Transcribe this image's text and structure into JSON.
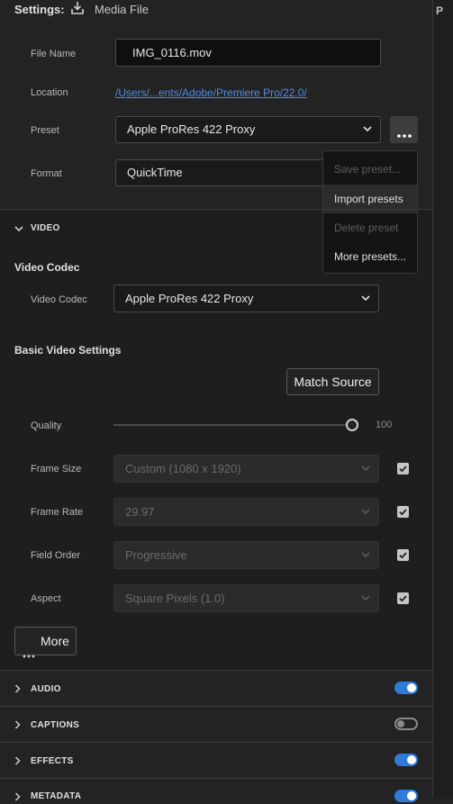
{
  "header": {
    "settings_label": "Settings:",
    "output_label": "Media File",
    "icon": "download-icon"
  },
  "fields": {
    "file_name": {
      "label": "File Name",
      "value": "IMG_0116.mov"
    },
    "location": {
      "label": "Location",
      "value": "/Users/...ents/Adobe/Premiere Pro/22.0/"
    },
    "preset": {
      "label": "Preset",
      "value": "Apple ProRes 422 Proxy"
    },
    "format": {
      "label": "Format",
      "value": "QuickTime"
    }
  },
  "preset_menu": {
    "items": [
      {
        "label": "Save preset...",
        "enabled": false
      },
      {
        "label": "Import presets",
        "enabled": true
      },
      {
        "label": "Delete preset",
        "enabled": false
      },
      {
        "label": "More presets...",
        "enabled": true
      }
    ]
  },
  "video": {
    "section_title": "VIDEO",
    "codec_heading": "Video Codec",
    "codec_label": "Video Codec",
    "codec_value": "Apple ProRes 422 Proxy",
    "basic_heading": "Basic Video Settings",
    "match_source": "Match Source",
    "quality_label": "Quality",
    "quality_value": "100",
    "quality_fraction": 1.0,
    "frame_size": {
      "label": "Frame Size",
      "value": "Custom (1080 x 1920)",
      "checked": true
    },
    "frame_rate": {
      "label": "Frame Rate",
      "value": "29.97",
      "checked": true
    },
    "field_order": {
      "label": "Field Order",
      "value": "Progressive",
      "checked": true
    },
    "aspect": {
      "label": "Aspect",
      "value": "Square Pixels (1.0)",
      "checked": true
    },
    "more_button": "More"
  },
  "sections": [
    {
      "title": "AUDIO",
      "enabled": true
    },
    {
      "title": "CAPTIONS",
      "enabled": false
    },
    {
      "title": "EFFECTS",
      "enabled": true
    },
    {
      "title": "METADATA",
      "enabled": true
    }
  ],
  "right_panel_letter": "P",
  "colors": {
    "accent": "#2f7bd9",
    "link": "#4c8ee8",
    "background": "#232323"
  }
}
